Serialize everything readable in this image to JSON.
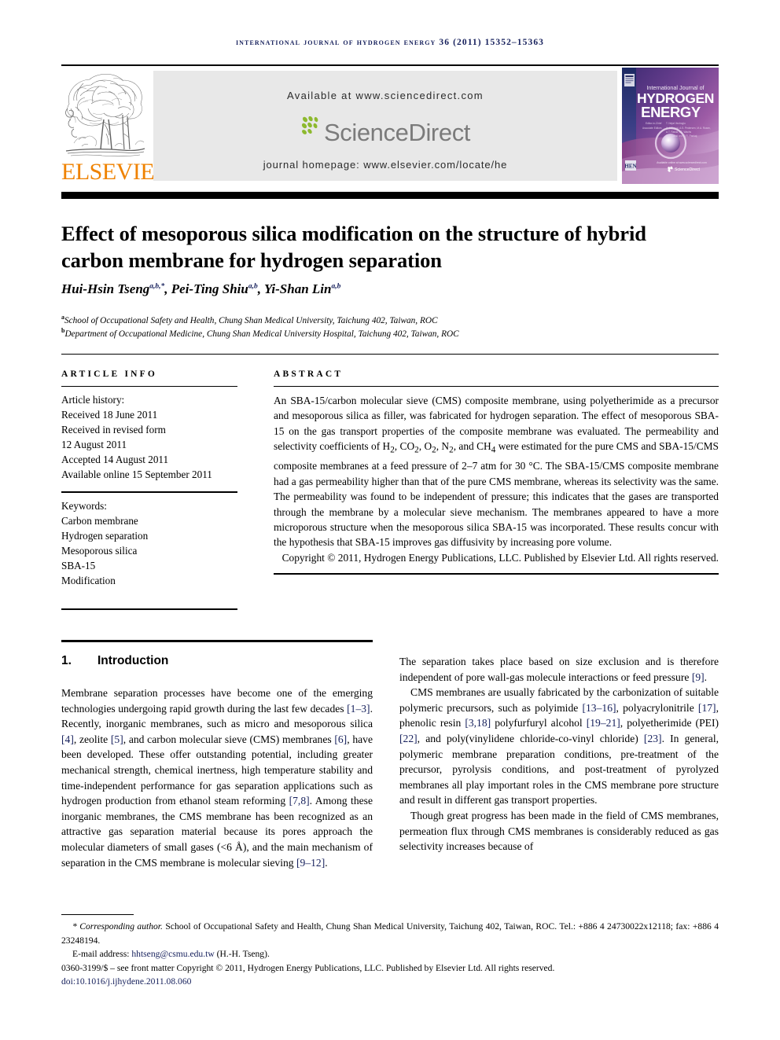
{
  "running_head": "International Journal of Hydrogen Energy 36 (2011) 15352–15363",
  "masthead": {
    "elsevier_logo_text": "ELSEVIER",
    "elsevier_tree_alt": "elsevier-tree-logo",
    "available_at": "Available at www.sciencedirect.com",
    "sciencedirect_logo_text": "ScienceDirect",
    "journal_homepage": "journal homepage: www.elsevier.com/locate/he",
    "cover": {
      "line1": "International Journal of",
      "line2": "HYDROGEN",
      "line3": "ENERGY",
      "badge": "HEN",
      "sciencedirect_mark": "ScienceDirect"
    },
    "colors": {
      "elsevier_orange": "#ef8200",
      "panel_gray": "#e8e8e8",
      "sciencedirect_gray": "#7b7b7b",
      "leaf_green": "#8db92e",
      "runhead_navy": "#16205c"
    }
  },
  "title": "Effect of mesoporous silica modification on the structure of hybrid carbon membrane for hydrogen separation",
  "authors": [
    {
      "name": "Hui-Hsin Tseng",
      "sup": "a,b,*"
    },
    {
      "name": "Pei-Ting Shiu",
      "sup": "a,b"
    },
    {
      "name": "Yi-Shan Lin",
      "sup": "a,b"
    }
  ],
  "affiliations": [
    {
      "marker": "a",
      "text": "School of Occupational Safety and Health, Chung Shan Medical University, Taichung 402, Taiwan, ROC"
    },
    {
      "marker": "b",
      "text": "Department of Occupational Medicine, Chung Shan Medical University Hospital, Taichung 402, Taiwan, ROC"
    }
  ],
  "article_info": {
    "heading": "ARTICLE INFO",
    "history_label": "Article history:",
    "history": [
      "Received 18 June 2011",
      "Received in revised form",
      "12 August 2011",
      "Accepted 14 August 2011",
      "Available online 15 September 2011"
    ],
    "keywords_label": "Keywords:",
    "keywords": [
      "Carbon membrane",
      "Hydrogen separation",
      "Mesoporous silica",
      "SBA-15",
      "Modification"
    ]
  },
  "abstract": {
    "heading": "ABSTRACT",
    "body": "An SBA-15/carbon molecular sieve (CMS) composite membrane, using polyetherimide as a precursor and mesoporous silica as filler, was fabricated for hydrogen separation. The effect of mesoporous SBA-15 on the gas transport properties of the composite membrane was evaluated. The permeability and selectivity coefficients of H2, CO2, O2, N2, and CH4 were estimated for the pure CMS and SBA-15/CMS composite membranes at a feed pressure of 2–7 atm for 30 °C. The SBA-15/CMS composite membrane had a gas permeability higher than that of the pure CMS membrane, whereas its selectivity was the same. The permeability was found to be independent of pressure; this indicates that the gases are transported through the membrane by a molecular sieve mechanism. The membranes appeared to have a more microporous structure when the mesoporous silica SBA-15 was incorporated. These results concur with the hypothesis that SBA-15 improves gas diffusivity by increasing pore volume.",
    "copyright": "Copyright © 2011, Hydrogen Energy Publications, LLC. Published by Elsevier Ltd. All rights reserved."
  },
  "section": {
    "number": "1.",
    "title": "Introduction"
  },
  "body": {
    "left_paragraph_1": "Membrane separation processes have become one of the emerging technologies undergoing rapid growth during the last few decades [1–3]. Recently, inorganic membranes, such as micro and mesoporous silica [4], zeolite [5], and carbon molecular sieve (CMS) membranes [6], have been developed. These offer outstanding potential, including greater mechanical strength, chemical inertness, high temperature stability and time-independent performance for gas separation applications such as hydrogen production from ethanol steam reforming [7,8]. Among these inorganic membranes, the CMS membrane has been recognized as an attractive gas separation material because its pores approach the molecular diameters of small gases (<6 Å), and the main mechanism of separation in the CMS membrane is molecular sieving [9–12].",
    "right_paragraph_1": "The separation takes place based on size exclusion and is therefore independent of pore wall-gas molecule interactions or feed pressure [9].",
    "right_paragraph_2": "CMS membranes are usually fabricated by the carbonization of suitable polymeric precursors, such as polyimide [13–16], polyacrylonitrile [17], phenolic resin [3,18] polyfurfuryl alcohol [19–21], polyetherimide (PEI) [22], and poly(vinylidene chloride-co-vinyl chloride) [23]. In general, polymeric membrane preparation conditions, pre-treatment of the precursor, pyrolysis conditions, and post-treatment of pyrolyzed membranes all play important roles in the CMS membrane pore structure and result in different gas transport properties.",
    "right_paragraph_3": "Though great progress has been made in the field of CMS membranes, permeation flux through CMS membranes is considerably reduced as gas selectivity increases because of"
  },
  "footnote": {
    "corresponding_label": "* Corresponding author.",
    "corresponding_text": "School of Occupational Safety and Health, Chung Shan Medical University, Taichung 402, Taiwan, ROC. Tel.: +886 4 24730022x12118; fax: +886 4 23248194.",
    "email_label": "E-mail address:",
    "email": "hhtseng@csmu.edu.tw",
    "email_suffix": "(H.-H. Tseng).",
    "issn_line": "0360-3199/$ – see front matter Copyright © 2011, Hydrogen Energy Publications, LLC. Published by Elsevier Ltd. All rights reserved.",
    "doi": "doi:10.1016/j.ijhydene.2011.08.060"
  }
}
